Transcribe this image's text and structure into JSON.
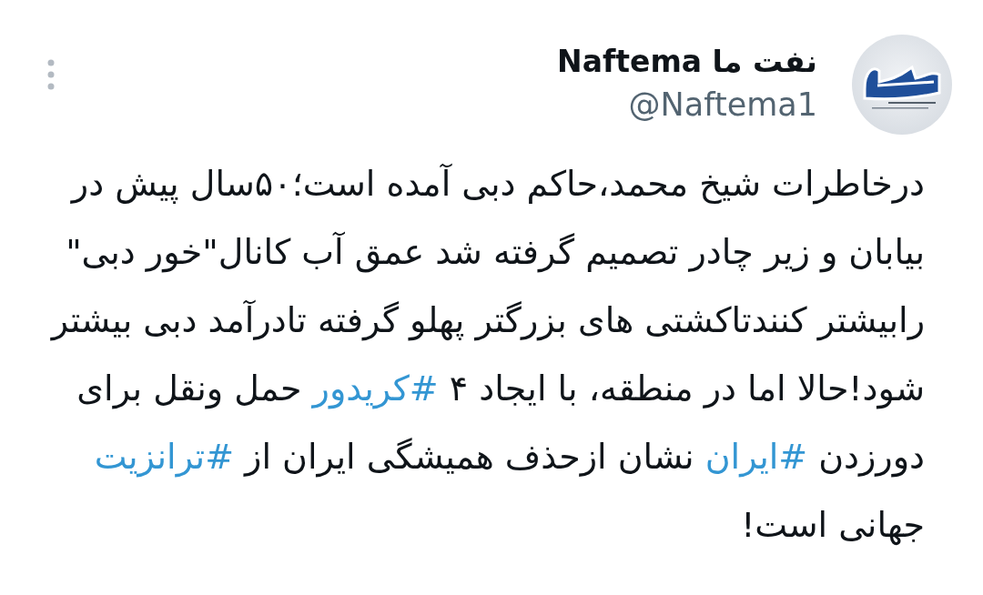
{
  "tweet": {
    "author": {
      "name": "نفت ما Naftema",
      "handle": "@Naftema1"
    },
    "body": [
      {
        "kind": "text",
        "text": "درخاطرات شیخ محمد،حاکم دبی آمده است؛۵۰سال پیش در بیابان و زیر چادر تصمیم گرفته شد عمق آب کانال\"خور دبی\" رابیشتر کنندتاکشتی های بزرگتر پهلو گرفته تادرآمد دبی بیشتر شود!حالا اما در منطقه، با ایجاد ۴ "
      },
      {
        "kind": "hashtag",
        "text": "#کریدور"
      },
      {
        "kind": "text",
        "text": " حمل ونقل برای دورزدن "
      },
      {
        "kind": "hashtag",
        "text": "#ایران"
      },
      {
        "kind": "text",
        "text": " نشان ازحذف همیشگی ایران از "
      },
      {
        "kind": "hashtag",
        "text": "#ترانزیت"
      },
      {
        "kind": "text",
        "text": " جهانی است!"
      }
    ]
  }
}
